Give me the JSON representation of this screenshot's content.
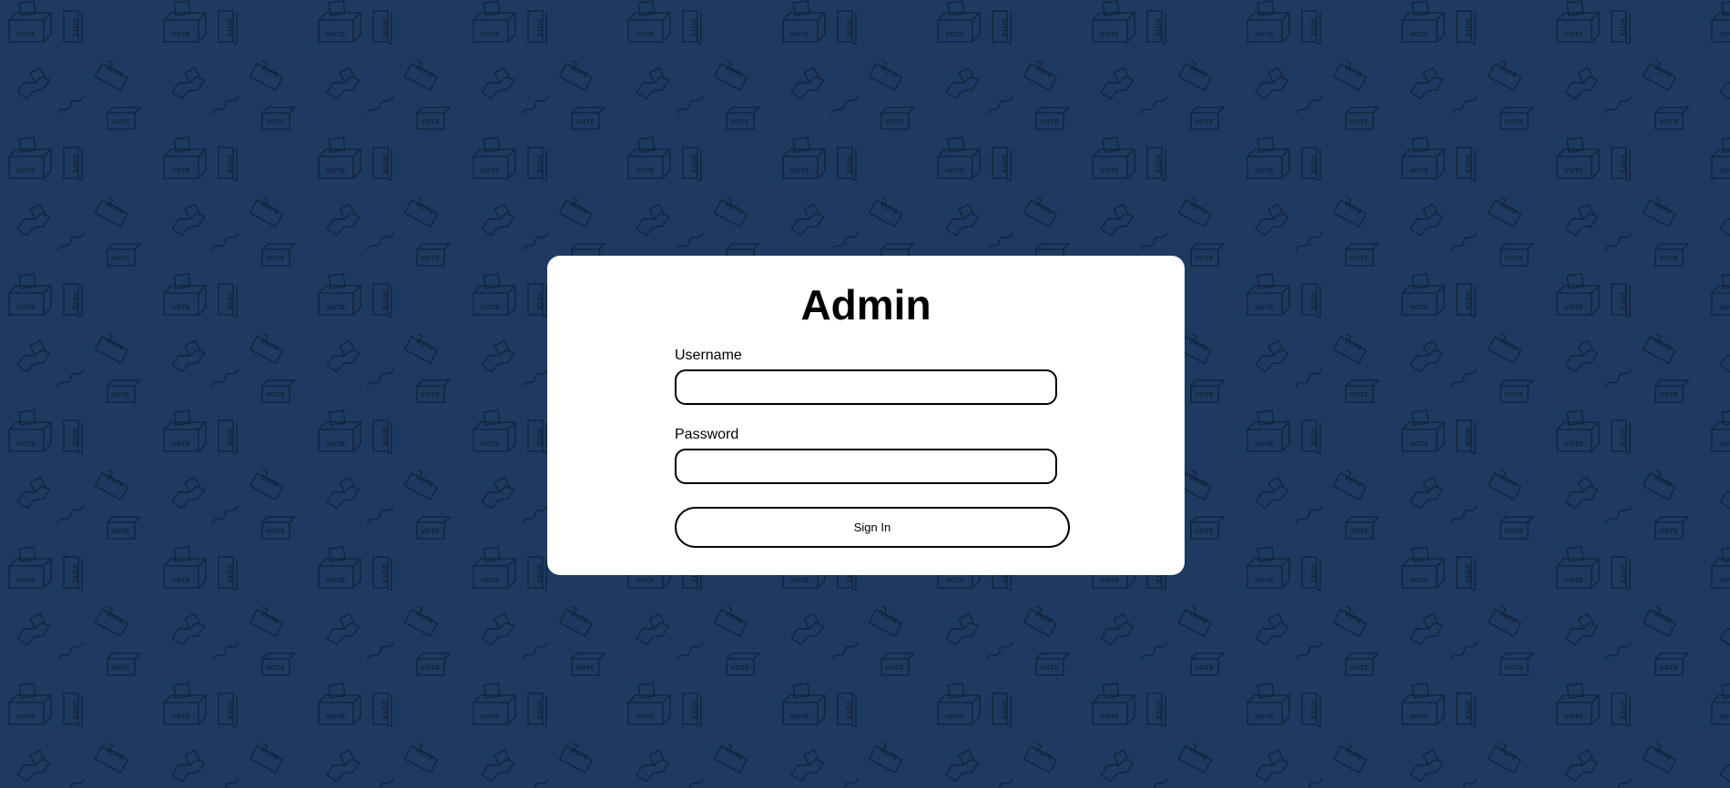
{
  "page": {
    "background_color": "#1f3a60",
    "pattern_color": "#10213a",
    "pattern_text": "VOTE",
    "pattern_icons": [
      "ballot-box-icon",
      "hand-icon",
      "vote-sign-icon"
    ]
  },
  "login_card": {
    "title": "Admin",
    "username": {
      "label": "Username",
      "value": "",
      "placeholder": ""
    },
    "password": {
      "label": "Password",
      "value": "",
      "placeholder": ""
    },
    "submit_label": "Sign In"
  }
}
